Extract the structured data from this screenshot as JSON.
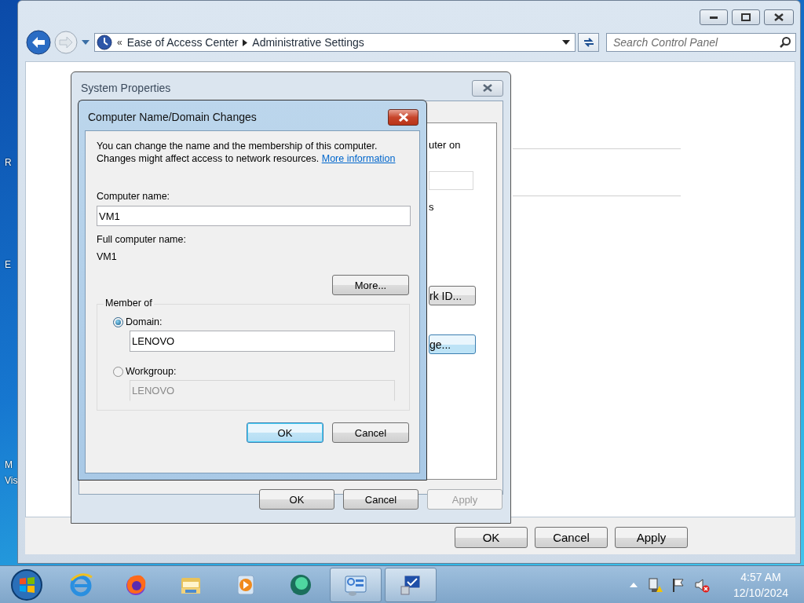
{
  "desktop": {
    "icon_labels": [
      {
        "text": "R"
      },
      {
        "text": "E"
      },
      {
        "text": "M"
      },
      {
        "text": "Vis"
      }
    ]
  },
  "control_panel": {
    "address_prefix": "«",
    "breadcrumb": [
      "Ease of Access Center",
      "Administrative Settings"
    ],
    "search": {
      "placeholder": "Search Control Panel"
    },
    "buttons": [
      {
        "label": "OK",
        "disabled": false
      },
      {
        "label": "Cancel",
        "disabled": false
      },
      {
        "label": "Apply",
        "disabled": false
      }
    ]
  },
  "system_properties": {
    "title": "System Properties",
    "texts": [
      "uter on",
      "s"
    ],
    "tab_buttons": [
      {
        "label": "rk ID...",
        "focused": false
      },
      {
        "label": "ge...",
        "focused": true
      }
    ],
    "buttons": [
      {
        "label": "OK",
        "disabled": false
      },
      {
        "label": "Cancel",
        "disabled": false
      },
      {
        "label": "Apply",
        "disabled": true
      }
    ]
  },
  "dialog": {
    "title": "Computer Name/Domain Changes",
    "description": "You can change the name and the membership of this computer. Changes might affect access to network resources.",
    "link": "More information",
    "computer_name_label": "Computer name:",
    "computer_name": "VM1",
    "full_name_label": "Full computer name:",
    "full_name": "VM1",
    "more_button": "More...",
    "member_of": "Member of",
    "options": [
      {
        "label": "Domain:",
        "selected": true,
        "value": "LENOVO"
      },
      {
        "label": "Workgroup:",
        "selected": false,
        "value": "LENOVO"
      }
    ],
    "buttons": [
      {
        "label": "OK",
        "default": true
      },
      {
        "label": "Cancel",
        "default": false
      }
    ]
  },
  "taskbar": {
    "apps": [
      {
        "kind": "browser-e",
        "active": false
      },
      {
        "kind": "fox",
        "active": false
      },
      {
        "kind": "folder",
        "active": false
      },
      {
        "kind": "player",
        "active": false
      },
      {
        "kind": "chat",
        "active": false
      },
      {
        "kind": "panel",
        "active": true
      },
      {
        "kind": "network",
        "active": true
      }
    ],
    "time": "4:57 AM",
    "date": "12/10/2024"
  }
}
